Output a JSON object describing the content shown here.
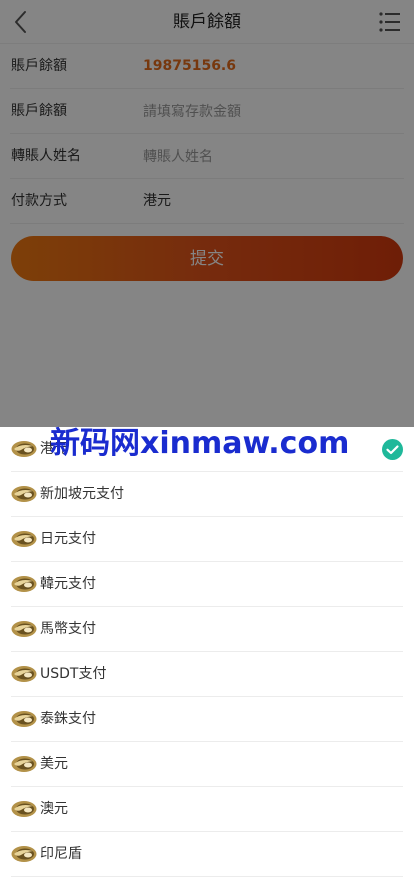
{
  "header": {
    "title": "賬戶餘額",
    "back_icon": "chevron-left-icon",
    "menu_icon": "list-menu-icon"
  },
  "form": {
    "balance_label": "賬戶餘額",
    "balance_value": "19875156.6",
    "amount_label": "賬戶餘額",
    "amount_placeholder": "請填寫存款金額",
    "name_label": "轉賬人姓名",
    "name_placeholder": "轉賬人姓名",
    "method_label": "付款方式",
    "method_value": "港元",
    "submit_label": "提交"
  },
  "colors": {
    "accent": "#e56b1c",
    "button_gradient_start": "#f07a12",
    "button_gradient_end": "#d43a0e",
    "check": "#1fb89a",
    "watermark": "#1a2ccf"
  },
  "payment_sheet": {
    "selected_index": 0,
    "items": [
      {
        "label": "港元"
      },
      {
        "label": "新加坡元支付"
      },
      {
        "label": "日元支付"
      },
      {
        "label": "韓元支付"
      },
      {
        "label": "馬幣支付"
      },
      {
        "label": "USDT支付"
      },
      {
        "label": "泰銖支付"
      },
      {
        "label": "美元"
      },
      {
        "label": "澳元"
      },
      {
        "label": "印尼盾"
      }
    ]
  },
  "watermark": {
    "text": "新码网xinmaw.com"
  }
}
